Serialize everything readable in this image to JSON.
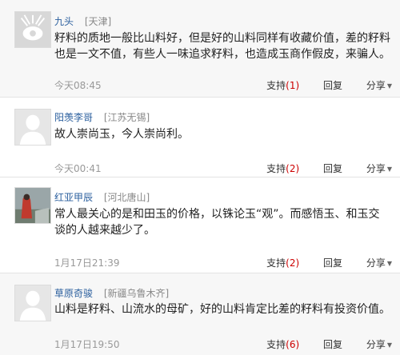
{
  "comments": [
    {
      "user": "九头",
      "location": "[天津]",
      "text": "籽料的质地一般比山料好，但是好的山料同样有收藏价值，差的籽料也是一文不值，有些人一味追求籽料，也造成玉商作假皮，来骗人。",
      "time": "今天08:45",
      "support_label": "支持",
      "support_count": "(1)",
      "reply_label": "回复",
      "share_label": "分享"
    },
    {
      "user": "阳羡李哥",
      "location": "[江苏无锡]",
      "text": "故人崇尚玉，今人崇尚利。",
      "time": "今天00:41",
      "support_label": "支持",
      "support_count": "(2)",
      "reply_label": "回复",
      "share_label": "分享"
    },
    {
      "user": "红亚甲辰",
      "location": "[河北唐山]",
      "text": "常人最关心的是和田玉的价格，以铢论玉“观”。而感悟玉、和玉交谈的人越来越少了。",
      "time": "1月17日21:39",
      "support_label": "支持",
      "support_count": "(2)",
      "reply_label": "回复",
      "share_label": "分享"
    },
    {
      "user": "草原奇骏",
      "location": "[新疆乌鲁木齐]",
      "text": "山料是籽料、山流水的母矿，好的山料肯定比差的籽料有投资价值。",
      "time": "1月17日19:50",
      "support_label": "支持",
      "support_count": "(6)",
      "reply_label": "回复",
      "share_label": "分享"
    }
  ],
  "colors": {
    "username": "#2b5f9e",
    "count": "#cc0000",
    "alt_background": "#f7f7f7"
  }
}
